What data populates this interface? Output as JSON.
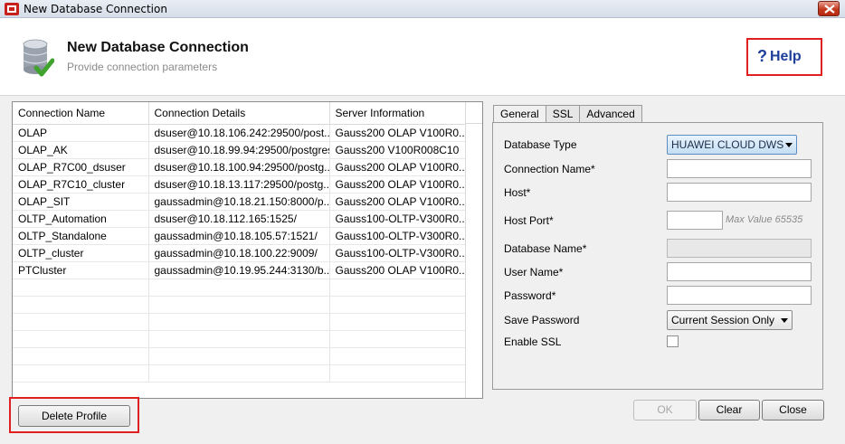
{
  "window": {
    "title": "New Database Connection"
  },
  "header": {
    "title": "New Database Connection",
    "subtitle": "Provide connection parameters",
    "help_label": "Help",
    "help_icon": "?"
  },
  "table": {
    "columns": [
      "Connection Name",
      "Connection Details",
      "Server Information"
    ],
    "rows": [
      [
        "OLAP",
        "dsuser@10.18.106.242:29500/post...",
        "Gauss200 OLAP V100R0..."
      ],
      [
        "OLAP_AK",
        "dsuser@10.18.99.94:29500/postgres",
        "Gauss200 V100R008C10"
      ],
      [
        "OLAP_R7C00_dsuser",
        "dsuser@10.18.100.94:29500/postg...",
        "Gauss200 OLAP V100R0..."
      ],
      [
        "OLAP_R7C10_cluster",
        "dsuser@10.18.13.117:29500/postg...",
        "Gauss200 OLAP V100R0..."
      ],
      [
        "OLAP_SIT",
        "gaussadmin@10.18.21.150:8000/p...",
        "Gauss200 OLAP V100R0..."
      ],
      [
        "OLTP_Automation",
        "dsuser@10.18.112.165:1525/",
        "Gauss100-OLTP-V300R0..."
      ],
      [
        "OLTP_Standalone",
        "gaussadmin@10.18.105.57:1521/",
        "Gauss100-OLTP-V300R0..."
      ],
      [
        "OLTP_cluster",
        "gaussadmin@10.18.100.22:9009/",
        "Gauss100-OLTP-V300R0..."
      ],
      [
        "PTCluster",
        "gaussadmin@10.19.95.244:3130/b...",
        "Gauss200 OLAP V100R0..."
      ]
    ],
    "empty_rows": 6
  },
  "buttons": {
    "delete_profile": "Delete Profile",
    "ok": "OK",
    "clear": "Clear",
    "close": "Close"
  },
  "tabs": [
    "General",
    "SSL",
    "Advanced"
  ],
  "form": {
    "database_type_label": "Database Type",
    "database_type_value": "HUAWEI CLOUD DWS",
    "connection_name_label": "Connection Name*",
    "connection_name_value": "",
    "host_label": "Host*",
    "host_value": "",
    "host_port_label": "Host Port*",
    "host_port_value": "",
    "host_port_hint": "Max Value 65535",
    "database_name_label": "Database Name*",
    "database_name_value": "",
    "user_name_label": "User Name*",
    "user_name_value": "",
    "password_label": "Password*",
    "password_value": "",
    "save_password_label": "Save Password",
    "save_password_value": "Current Session Only",
    "enable_ssl_label": "Enable SSL",
    "enable_ssl_checked": false
  },
  "colors": {
    "highlight_border": "#e02020",
    "help_text": "#1d3f9a",
    "db_type_select": "#c4ddf3"
  }
}
